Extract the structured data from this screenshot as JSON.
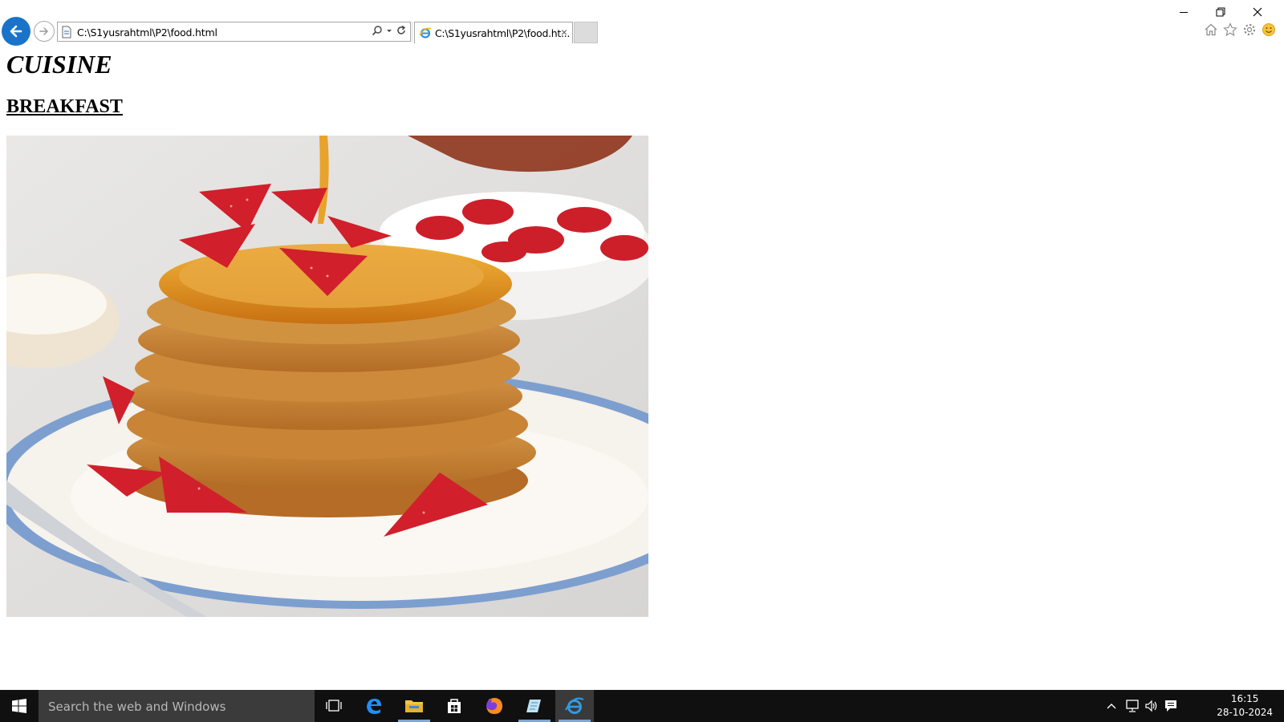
{
  "browser": {
    "address_url": "C:\\S1yusrahtml\\P2\\food.html",
    "tab_title": "C:\\S1yusrahtml\\P2\\food.ht...",
    "tab_close": "×"
  },
  "page": {
    "title": "CUISINE",
    "heading": "BREAKFAST",
    "image": "pancake-stack-with-strawberries-and-syrup"
  },
  "taskbar": {
    "search_placeholder": "Search the web and Windows",
    "apps": [
      "task-view",
      "edge",
      "file-explorer",
      "store",
      "firefox",
      "notepad",
      "internet-explorer"
    ],
    "clock_time": "16:15",
    "clock_date": "28-10-2024"
  },
  "colors": {
    "ie_blue": "#1a73c9",
    "taskbar_bg": "#101010",
    "search_bg": "#3b3b3b"
  }
}
